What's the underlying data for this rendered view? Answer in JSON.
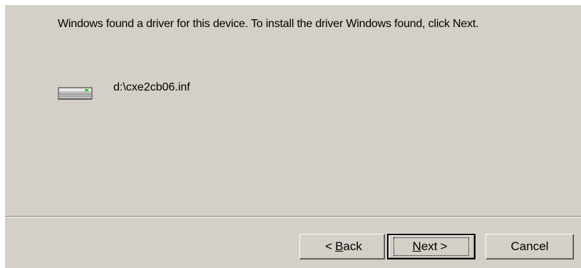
{
  "message": "Windows found a driver for this device. To install the driver Windows found, click Next.",
  "file": {
    "icon": "drive-icon",
    "path": "d:\\cxe2cb06.inf"
  },
  "buttons": {
    "back": {
      "arrow": "<",
      "accel": "B",
      "rest": "ack"
    },
    "next": {
      "accel": "N",
      "rest": "ext",
      "arrow": ">"
    },
    "cancel": "Cancel"
  },
  "colors": {
    "dialog_bg": "#d4d0c8",
    "drive_led": "#1fd61f"
  }
}
